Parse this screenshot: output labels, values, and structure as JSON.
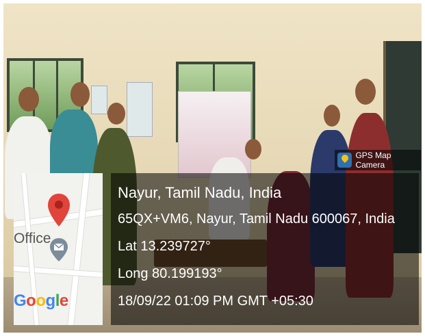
{
  "badge": {
    "label": "GPS Map Camera",
    "icon": "gps-map-camera-icon"
  },
  "map": {
    "place_label": "Office",
    "brand": {
      "letters": [
        "G",
        "o",
        "o",
        "g",
        "l",
        "e"
      ],
      "colors": [
        "#4285F4",
        "#EA4335",
        "#FBBC05",
        "#4285F4",
        "#34A853",
        "#EA4335"
      ]
    },
    "pin_color": "#e0443a",
    "marker_icon": "mail-icon"
  },
  "location": {
    "place": "Nayur, Tamil Nadu, India",
    "address": "65QX+VM6, Nayur, Tamil Nadu 600067, India",
    "lat": "Lat 13.239727°",
    "long": "Long 80.199193°",
    "timestamp": "18/09/22 01:09 PM GMT +05:30"
  }
}
